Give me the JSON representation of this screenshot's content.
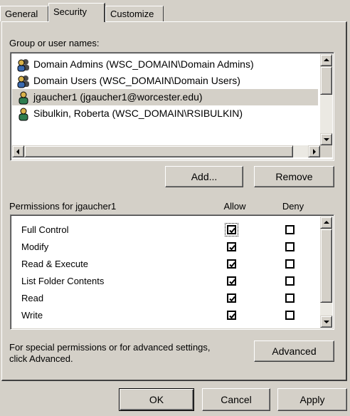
{
  "tabs": [
    {
      "label": "General",
      "active": false
    },
    {
      "label": "Security",
      "active": true
    },
    {
      "label": "Customize",
      "active": false
    }
  ],
  "users": {
    "label": "Group or user names:",
    "items": [
      {
        "label": "Domain Admins (WSC_DOMAIN\\Domain Admins)",
        "icon": "group-icon",
        "selected": false
      },
      {
        "label": "Domain Users (WSC_DOMAIN\\Domain Users)",
        "icon": "group-icon",
        "selected": false
      },
      {
        "label": "jgaucher1 (jgaucher1@worcester.edu)",
        "icon": "user-icon",
        "selected": true
      },
      {
        "label": "Sibulkin, Roberta (WSC_DOMAIN\\RSIBULKIN)",
        "icon": "user-icon",
        "selected": false
      }
    ],
    "add_label": "Add...",
    "remove_label": "Remove"
  },
  "permissions": {
    "title": "Permissions for jgaucher1",
    "allow_header": "Allow",
    "deny_header": "Deny",
    "rows": [
      {
        "name": "Full Control",
        "allow": true,
        "deny": false
      },
      {
        "name": "Modify",
        "allow": true,
        "deny": false
      },
      {
        "name": "Read & Execute",
        "allow": true,
        "deny": false
      },
      {
        "name": "List Folder Contents",
        "allow": true,
        "deny": false
      },
      {
        "name": "Read",
        "allow": true,
        "deny": false
      },
      {
        "name": "Write",
        "allow": true,
        "deny": false
      }
    ]
  },
  "advanced": {
    "text_line1": "For special permissions or for advanced settings,",
    "text_line2": "click Advanced.",
    "button_label": "Advanced"
  },
  "footer": {
    "ok_label": "OK",
    "cancel_label": "Cancel",
    "apply_label": "Apply"
  }
}
